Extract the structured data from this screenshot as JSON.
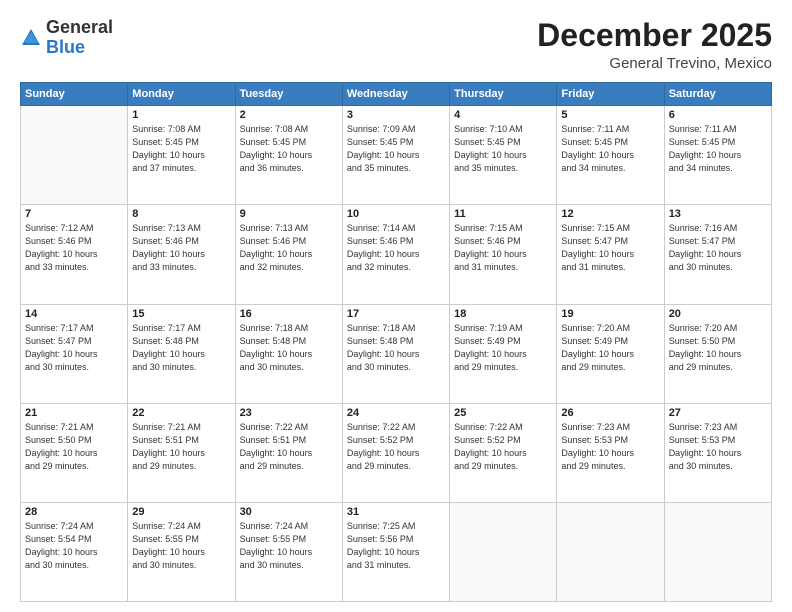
{
  "logo": {
    "general": "General",
    "blue": "Blue"
  },
  "header": {
    "month": "December 2025",
    "location": "General Trevino, Mexico"
  },
  "weekdays": [
    "Sunday",
    "Monday",
    "Tuesday",
    "Wednesday",
    "Thursday",
    "Friday",
    "Saturday"
  ],
  "weeks": [
    [
      {
        "day": "",
        "info": ""
      },
      {
        "day": "1",
        "info": "Sunrise: 7:08 AM\nSunset: 5:45 PM\nDaylight: 10 hours\nand 37 minutes."
      },
      {
        "day": "2",
        "info": "Sunrise: 7:08 AM\nSunset: 5:45 PM\nDaylight: 10 hours\nand 36 minutes."
      },
      {
        "day": "3",
        "info": "Sunrise: 7:09 AM\nSunset: 5:45 PM\nDaylight: 10 hours\nand 35 minutes."
      },
      {
        "day": "4",
        "info": "Sunrise: 7:10 AM\nSunset: 5:45 PM\nDaylight: 10 hours\nand 35 minutes."
      },
      {
        "day": "5",
        "info": "Sunrise: 7:11 AM\nSunset: 5:45 PM\nDaylight: 10 hours\nand 34 minutes."
      },
      {
        "day": "6",
        "info": "Sunrise: 7:11 AM\nSunset: 5:45 PM\nDaylight: 10 hours\nand 34 minutes."
      }
    ],
    [
      {
        "day": "7",
        "info": "Sunrise: 7:12 AM\nSunset: 5:46 PM\nDaylight: 10 hours\nand 33 minutes."
      },
      {
        "day": "8",
        "info": "Sunrise: 7:13 AM\nSunset: 5:46 PM\nDaylight: 10 hours\nand 33 minutes."
      },
      {
        "day": "9",
        "info": "Sunrise: 7:13 AM\nSunset: 5:46 PM\nDaylight: 10 hours\nand 32 minutes."
      },
      {
        "day": "10",
        "info": "Sunrise: 7:14 AM\nSunset: 5:46 PM\nDaylight: 10 hours\nand 32 minutes."
      },
      {
        "day": "11",
        "info": "Sunrise: 7:15 AM\nSunset: 5:46 PM\nDaylight: 10 hours\nand 31 minutes."
      },
      {
        "day": "12",
        "info": "Sunrise: 7:15 AM\nSunset: 5:47 PM\nDaylight: 10 hours\nand 31 minutes."
      },
      {
        "day": "13",
        "info": "Sunrise: 7:16 AM\nSunset: 5:47 PM\nDaylight: 10 hours\nand 30 minutes."
      }
    ],
    [
      {
        "day": "14",
        "info": "Sunrise: 7:17 AM\nSunset: 5:47 PM\nDaylight: 10 hours\nand 30 minutes."
      },
      {
        "day": "15",
        "info": "Sunrise: 7:17 AM\nSunset: 5:48 PM\nDaylight: 10 hours\nand 30 minutes."
      },
      {
        "day": "16",
        "info": "Sunrise: 7:18 AM\nSunset: 5:48 PM\nDaylight: 10 hours\nand 30 minutes."
      },
      {
        "day": "17",
        "info": "Sunrise: 7:18 AM\nSunset: 5:48 PM\nDaylight: 10 hours\nand 30 minutes."
      },
      {
        "day": "18",
        "info": "Sunrise: 7:19 AM\nSunset: 5:49 PM\nDaylight: 10 hours\nand 29 minutes."
      },
      {
        "day": "19",
        "info": "Sunrise: 7:20 AM\nSunset: 5:49 PM\nDaylight: 10 hours\nand 29 minutes."
      },
      {
        "day": "20",
        "info": "Sunrise: 7:20 AM\nSunset: 5:50 PM\nDaylight: 10 hours\nand 29 minutes."
      }
    ],
    [
      {
        "day": "21",
        "info": "Sunrise: 7:21 AM\nSunset: 5:50 PM\nDaylight: 10 hours\nand 29 minutes."
      },
      {
        "day": "22",
        "info": "Sunrise: 7:21 AM\nSunset: 5:51 PM\nDaylight: 10 hours\nand 29 minutes."
      },
      {
        "day": "23",
        "info": "Sunrise: 7:22 AM\nSunset: 5:51 PM\nDaylight: 10 hours\nand 29 minutes."
      },
      {
        "day": "24",
        "info": "Sunrise: 7:22 AM\nSunset: 5:52 PM\nDaylight: 10 hours\nand 29 minutes."
      },
      {
        "day": "25",
        "info": "Sunrise: 7:22 AM\nSunset: 5:52 PM\nDaylight: 10 hours\nand 29 minutes."
      },
      {
        "day": "26",
        "info": "Sunrise: 7:23 AM\nSunset: 5:53 PM\nDaylight: 10 hours\nand 29 minutes."
      },
      {
        "day": "27",
        "info": "Sunrise: 7:23 AM\nSunset: 5:53 PM\nDaylight: 10 hours\nand 30 minutes."
      }
    ],
    [
      {
        "day": "28",
        "info": "Sunrise: 7:24 AM\nSunset: 5:54 PM\nDaylight: 10 hours\nand 30 minutes."
      },
      {
        "day": "29",
        "info": "Sunrise: 7:24 AM\nSunset: 5:55 PM\nDaylight: 10 hours\nand 30 minutes."
      },
      {
        "day": "30",
        "info": "Sunrise: 7:24 AM\nSunset: 5:55 PM\nDaylight: 10 hours\nand 30 minutes."
      },
      {
        "day": "31",
        "info": "Sunrise: 7:25 AM\nSunset: 5:56 PM\nDaylight: 10 hours\nand 31 minutes."
      },
      {
        "day": "",
        "info": ""
      },
      {
        "day": "",
        "info": ""
      },
      {
        "day": "",
        "info": ""
      }
    ]
  ]
}
